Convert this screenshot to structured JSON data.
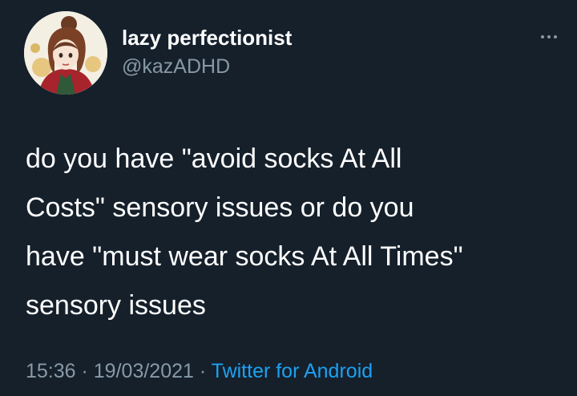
{
  "user": {
    "display_name": "lazy perfectionist",
    "handle": "@kazADHD"
  },
  "more_icon": "more-horizontal-icon",
  "tweet": {
    "lines": [
      "do you have \"avoid socks At All",
      "Costs\" sensory issues or do you",
      "have \"must wear socks At All Times\"",
      "sensory issues"
    ]
  },
  "meta": {
    "time": "15:36",
    "separator": " · ",
    "date": "19/03/2021",
    "separator2": " · ",
    "source": "Twitter for Android"
  },
  "colors": {
    "background": "#15202b",
    "text": "#ffffff",
    "secondary": "#8899a6",
    "link": "#1da1f2"
  }
}
